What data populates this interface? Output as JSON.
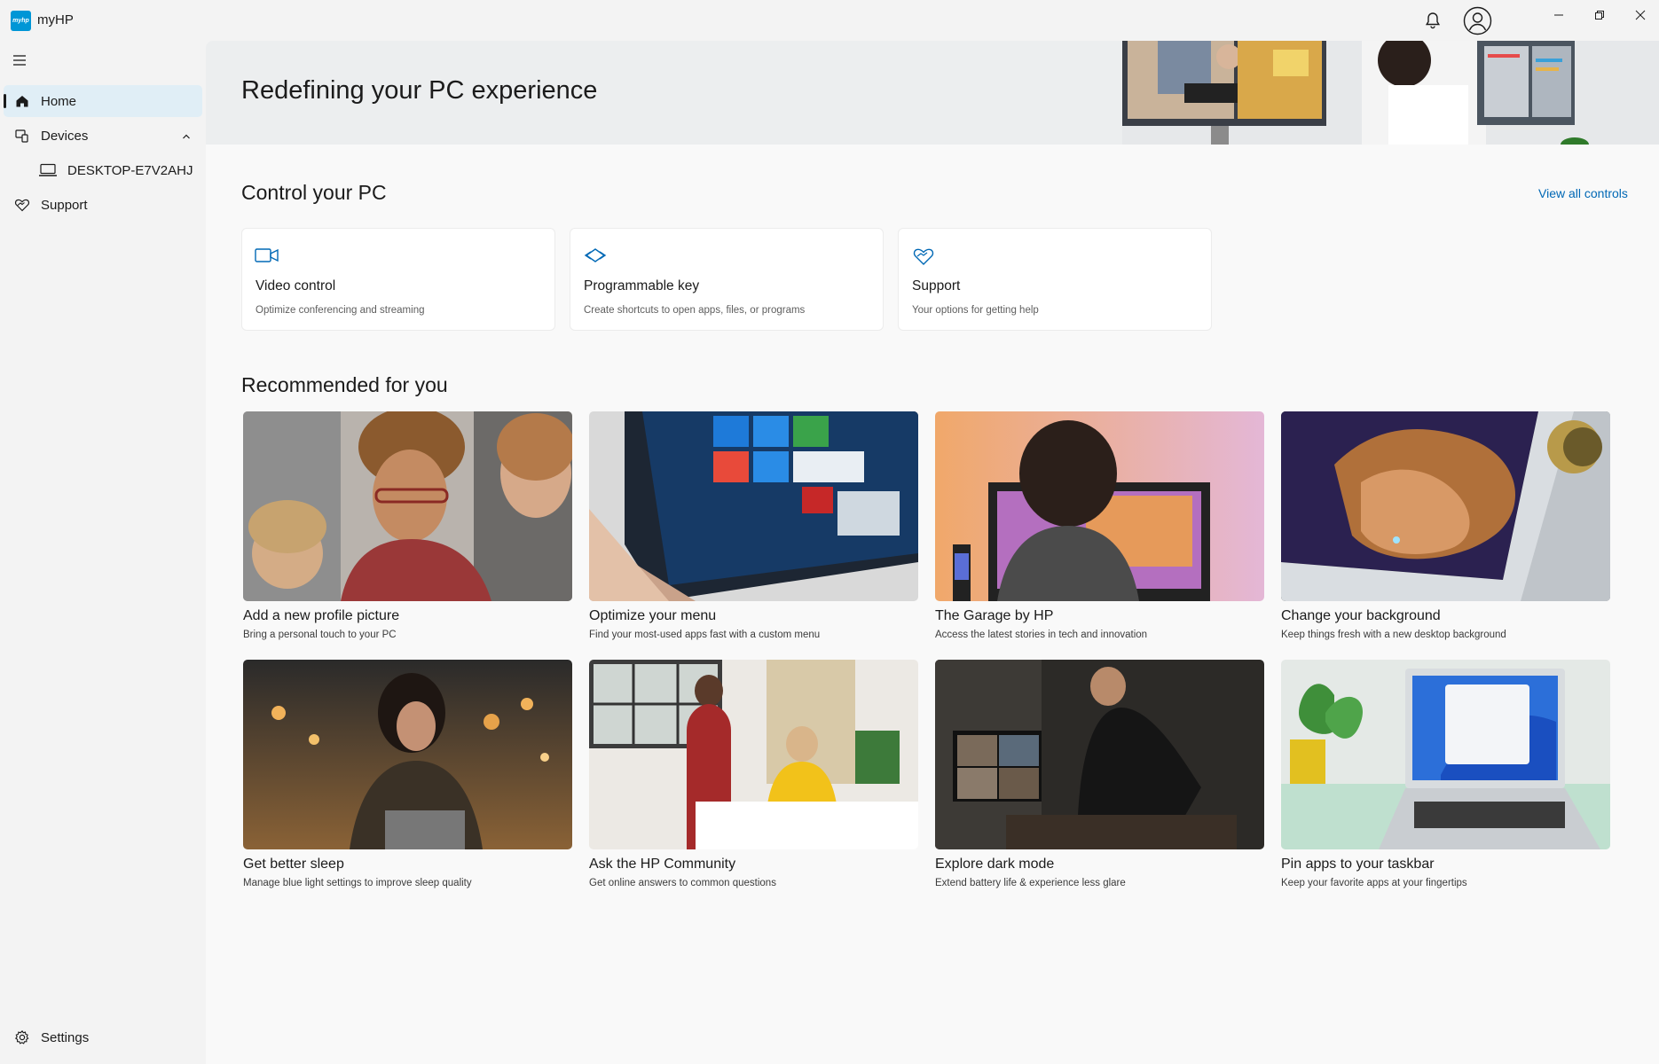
{
  "app": {
    "title": "myHP",
    "logo_text": "myhp"
  },
  "titlebar": {
    "icons": [
      "bell-icon",
      "account-icon",
      "minimize-icon",
      "restore-icon",
      "close-icon"
    ]
  },
  "sidebar": {
    "items": [
      {
        "label": "Home",
        "icon": "home-icon",
        "selected": true
      },
      {
        "label": "Devices",
        "icon": "devices-icon",
        "expanded": true
      },
      {
        "label": "DESKTOP-E7V2AHJ",
        "icon": "laptop-icon"
      },
      {
        "label": "Support",
        "icon": "support-heart-icon"
      }
    ],
    "settings_label": "Settings"
  },
  "hero": {
    "title": "Redefining your PC experience"
  },
  "control": {
    "title": "Control your PC",
    "view_all": "View all controls",
    "cards": [
      {
        "title": "Video control",
        "desc": "Optimize conferencing and streaming",
        "icon": "video-camera-icon"
      },
      {
        "title": "Programmable key",
        "desc": "Create shortcuts to open apps, files, or programs",
        "icon": "programmable-key-icon"
      },
      {
        "title": "Support",
        "desc": "Your options for getting help",
        "icon": "support-heart-icon"
      }
    ]
  },
  "recommended": {
    "title": "Recommended for you",
    "cards": [
      {
        "title": "Add a new profile picture",
        "desc": "Bring a personal touch to your PC"
      },
      {
        "title": "Optimize your menu",
        "desc": "Find your most-used apps fast with a custom menu"
      },
      {
        "title": "The Garage by HP",
        "desc": "Access the latest stories in tech and innovation"
      },
      {
        "title": "Change your background",
        "desc": "Keep things fresh with a new desktop background"
      },
      {
        "title": "Get better sleep",
        "desc": "Manage blue light settings to improve sleep quality"
      },
      {
        "title": "Ask the HP Community",
        "desc": "Get online answers to common questions"
      },
      {
        "title": "Explore dark mode",
        "desc": "Extend battery life & experience less glare"
      },
      {
        "title": "Pin apps to your taskbar",
        "desc": "Keep your favorite apps at your fingertips"
      }
    ]
  },
  "colors": {
    "accent": "#0068b5",
    "brand": "#0096d6",
    "selected_bg": "#e0eef6"
  }
}
